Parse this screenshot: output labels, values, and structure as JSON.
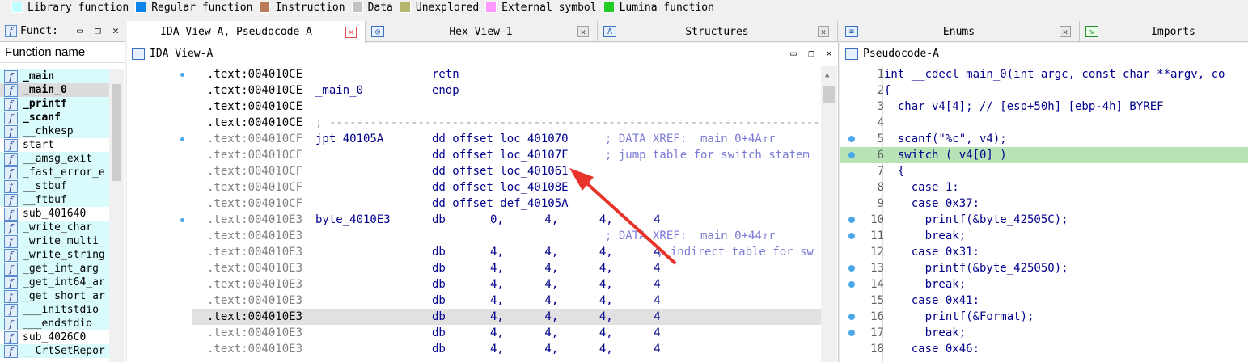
{
  "legend": [
    {
      "label": "Library function",
      "color": "#c0ffff"
    },
    {
      "label": "Regular function",
      "color": "#0a84e8"
    },
    {
      "label": "Instruction",
      "color": "#b97a57"
    },
    {
      "label": "Data",
      "color": "#c3c3c3"
    },
    {
      "label": "Unexplored",
      "color": "#b5b56d"
    },
    {
      "label": "External symbol",
      "color": "#ff99ff"
    },
    {
      "label": "Lumina function",
      "color": "#22cc22"
    }
  ],
  "functions_panel": {
    "tab_title": "Funct:",
    "column_header": "Function name",
    "items": [
      {
        "name": "_main",
        "bold": true,
        "lib": true
      },
      {
        "name": "_main_0",
        "bold": true,
        "lib": true,
        "selected": true
      },
      {
        "name": "_printf",
        "bold": true,
        "lib": true
      },
      {
        "name": "_scanf",
        "bold": true,
        "lib": true
      },
      {
        "name": "__chkesp",
        "bold": false,
        "lib": true
      },
      {
        "name": "start",
        "bold": false,
        "lib": false
      },
      {
        "name": "__amsg_exit",
        "bold": false,
        "lib": true
      },
      {
        "name": "_fast_error_e",
        "bold": false,
        "lib": true
      },
      {
        "name": "__stbuf",
        "bold": false,
        "lib": true
      },
      {
        "name": "__ftbuf",
        "bold": false,
        "lib": true
      },
      {
        "name": "sub_401640",
        "bold": false,
        "lib": false
      },
      {
        "name": "_write_char",
        "bold": false,
        "lib": true
      },
      {
        "name": "_write_multi_",
        "bold": false,
        "lib": true
      },
      {
        "name": "_write_string",
        "bold": false,
        "lib": true
      },
      {
        "name": "_get_int_arg",
        "bold": false,
        "lib": true
      },
      {
        "name": "_get_int64_ar",
        "bold": false,
        "lib": true
      },
      {
        "name": "_get_short_ar",
        "bold": false,
        "lib": true
      },
      {
        "name": "___initstdio",
        "bold": false,
        "lib": true
      },
      {
        "name": "___endstdio",
        "bold": false,
        "lib": true
      },
      {
        "name": "sub_4026C0",
        "bold": false,
        "lib": false
      },
      {
        "name": "__CrtSetRepor",
        "bold": false,
        "lib": true
      }
    ]
  },
  "tabs": {
    "ida_pseudo": "IDA View-A, Pseudocode-A",
    "hex": "Hex View-1",
    "structures": "Structures",
    "enums": "Enums",
    "imports": "Imports"
  },
  "ida_view": {
    "title": "IDA View-A",
    "lines": [
      {
        "addr": ".text:004010CE",
        "label": "",
        "mnem": "retn",
        "ops": "",
        "comment": "",
        "addr_dim": false
      },
      {
        "addr": ".text:004010CE",
        "label": "_main_0",
        "mnem": "endp",
        "ops": "",
        "comment": "",
        "addr_dim": false
      },
      {
        "addr": ".text:004010CE",
        "label": "",
        "mnem": "",
        "ops": "",
        "comment": "",
        "addr_dim": false
      },
      {
        "addr": ".text:004010CE",
        "label": "; ---------------------------------------------------------------------------",
        "mnem": "",
        "ops": "",
        "comment": "",
        "addr_dim": false,
        "separator": true
      },
      {
        "addr": ".text:004010CF",
        "label": "jpt_40105A",
        "mnem": "dd offset loc_401070",
        "ops": "",
        "comment": "; DATA XREF: _main_0+4A↑r",
        "addr_dim": true
      },
      {
        "addr": ".text:004010CF",
        "label": "",
        "mnem": "dd offset loc_40107F",
        "ops": "",
        "comment": "; jump table for switch statem",
        "addr_dim": true
      },
      {
        "addr": ".text:004010CF",
        "label": "",
        "mnem": "dd offset loc_401061",
        "ops": "",
        "comment": "",
        "addr_dim": true
      },
      {
        "addr": ".text:004010CF",
        "label": "",
        "mnem": "dd offset loc_40108E",
        "ops": "",
        "comment": "",
        "addr_dim": true
      },
      {
        "addr": ".text:004010CF",
        "label": "",
        "mnem": "dd offset def_40105A",
        "ops": "",
        "comment": "",
        "addr_dim": true
      },
      {
        "addr": ".text:004010E3",
        "label": "byte_4010E3",
        "mnem": "db",
        "ops": "0,      4,      4,      4",
        "comment": "",
        "addr_dim": true
      },
      {
        "addr": ".text:004010E3",
        "label": "",
        "mnem": "",
        "ops": "",
        "comment": "; DATA XREF: _main_0+44↑r",
        "addr_dim": true
      },
      {
        "addr": ".text:004010E3",
        "label": "",
        "mnem": "db",
        "ops": "4,      4,      4,      4",
        "comment": "; indirect table for sw",
        "addr_dim": true
      },
      {
        "addr": ".text:004010E3",
        "label": "",
        "mnem": "db",
        "ops": "4,      4,      4,      4",
        "comment": "",
        "addr_dim": true
      },
      {
        "addr": ".text:004010E3",
        "label": "",
        "mnem": "db",
        "ops": "4,      4,      4,      4",
        "comment": "",
        "addr_dim": true
      },
      {
        "addr": ".text:004010E3",
        "label": "",
        "mnem": "db",
        "ops": "4,      4,      4,      4",
        "comment": "",
        "addr_dim": true
      },
      {
        "addr": ".text:004010E3",
        "label": "",
        "mnem": "db",
        "ops": "4,      4,      4,      4",
        "comment": "",
        "addr_dim": false,
        "highlight": true
      },
      {
        "addr": ".text:004010E3",
        "label": "",
        "mnem": "db",
        "ops": "4,      4,      4,      4",
        "comment": "",
        "addr_dim": true
      },
      {
        "addr": ".text:004010E3",
        "label": "",
        "mnem": "db",
        "ops": "4,      4,      4,      4",
        "comment": "",
        "addr_dim": true
      }
    ]
  },
  "pseudocode": {
    "title": "Pseudocode-A",
    "lines": [
      {
        "n": "1",
        "text": "int __cdecl main_0(int argc, const char **argv, co",
        "dot": false
      },
      {
        "n": "2",
        "text": "{",
        "dot": false
      },
      {
        "n": "3",
        "text": "  char v4[4]; // [esp+50h] [ebp-4h] BYREF",
        "dot": false
      },
      {
        "n": "4",
        "text": "",
        "dot": false
      },
      {
        "n": "5",
        "text": "  scanf(\"%c\", v4);",
        "dot": true
      },
      {
        "n": "6",
        "text": "  switch ( v4[0] )",
        "dot": true,
        "highlight": true
      },
      {
        "n": "7",
        "text": "  {",
        "dot": false
      },
      {
        "n": "8",
        "text": "    case 1:",
        "dot": false
      },
      {
        "n": "9",
        "text": "    case 0x37:",
        "dot": false
      },
      {
        "n": "10",
        "text": "      printf(&byte_42505C);",
        "dot": true
      },
      {
        "n": "11",
        "text": "      break;",
        "dot": true
      },
      {
        "n": "12",
        "text": "    case 0x31:",
        "dot": false
      },
      {
        "n": "13",
        "text": "      printf(&byte_425050);",
        "dot": true
      },
      {
        "n": "14",
        "text": "      break;",
        "dot": true
      },
      {
        "n": "15",
        "text": "    case 0x41:",
        "dot": false
      },
      {
        "n": "16",
        "text": "      printf(&Format);",
        "dot": true
      },
      {
        "n": "17",
        "text": "      break;",
        "dot": true
      },
      {
        "n": "18",
        "text": "    case 0x46:",
        "dot": false
      }
    ]
  },
  "colors": {
    "arrow": "#e8332a",
    "highlight_green": "#b7e3b7",
    "code_blue": "#00008b",
    "number_green": "#008000"
  }
}
